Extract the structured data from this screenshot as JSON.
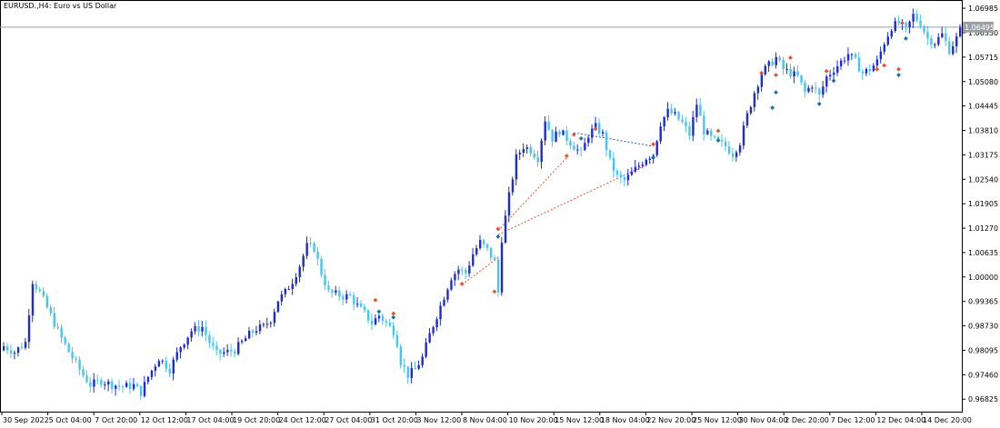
{
  "window": {
    "title": "EURUSD.,H4:  Euro vs US Dollar"
  },
  "price_line": {
    "price": 1.06495,
    "label": "1.06495",
    "color": "#9aa0a6"
  },
  "colors": {
    "bull": "#1d2bd6",
    "bear": "#45c5f2",
    "grid_frame": "#000000",
    "trend_red": "#e8522b",
    "trend_blue": "#1f5fa8",
    "arrow_up": "#1a6fa0",
    "arrow_down": "#e8522b"
  },
  "chart_data": {
    "type": "candlestick",
    "symbol": "EURUSD.",
    "timeframe": "H4",
    "ylim": [
      0.965,
      1.072
    ],
    "y_ticks": [
      "1.06985",
      "1.06350",
      "1.05715",
      "1.05080",
      "1.04445",
      "1.03810",
      "1.03175",
      "1.02540",
      "1.01905",
      "1.01270",
      "1.00635",
      "1.00000",
      "0.99365",
      "0.98730",
      "0.98095",
      "0.97460",
      "0.96825"
    ],
    "x_tick_labels": [
      "30 Sep 2022",
      "5 Oct 04:00",
      "7 Oct 20:00",
      "12 Oct 12:00",
      "17 Oct 04:00",
      "19 Oct 20:00",
      "24 Oct 12:00",
      "27 Oct 04:00",
      "31 Oct 20:00",
      "3 Nov 12:00",
      "8 Nov 04:00",
      "10 Nov 20:00",
      "15 Nov 12:00",
      "18 Nov 04:00",
      "22 Nov 20:00",
      "25 Nov 12:00",
      "30 Nov 04:00",
      "2 Dec 20:00",
      "7 Dec 12:00",
      "12 Dec 04:00",
      "14 Dec 20:00"
    ],
    "close_path": [
      [
        0,
        0.982
      ],
      [
        3,
        0.9805
      ],
      [
        6,
        0.983
      ],
      [
        8,
        0.999
      ],
      [
        10,
        0.996
      ],
      [
        13,
        0.99
      ],
      [
        16,
        0.984
      ],
      [
        19,
        0.979
      ],
      [
        22,
        0.9745
      ],
      [
        24,
        0.972
      ],
      [
        27,
        0.973
      ],
      [
        30,
        0.972
      ],
      [
        33,
        0.9715
      ],
      [
        36,
        0.9718
      ],
      [
        38,
        0.97
      ],
      [
        40,
        0.974
      ],
      [
        43,
        0.979
      ],
      [
        46,
        0.976
      ],
      [
        49,
        0.982
      ],
      [
        52,
        0.986
      ],
      [
        55,
        0.987
      ],
      [
        57,
        0.983
      ],
      [
        59,
        0.98
      ],
      [
        62,
        0.9805
      ],
      [
        64,
        0.981
      ],
      [
        66,
        0.983
      ],
      [
        68,
        0.985
      ],
      [
        70,
        0.9865
      ],
      [
        72,
        0.987
      ],
      [
        74,
        0.989
      ],
      [
        76,
        0.994
      ],
      [
        78,
        0.996
      ],
      [
        80,
        0.999
      ],
      [
        82,
        1.003
      ],
      [
        84,
        1.008
      ],
      [
        86,
        1.0075
      ],
      [
        88,
        1.001
      ],
      [
        90,
        0.996
      ],
      [
        92,
        0.9955
      ],
      [
        94,
        0.995
      ],
      [
        96,
        0.995
      ],
      [
        98,
        0.9925
      ],
      [
        100,
        0.9905
      ],
      [
        102,
        0.988
      ],
      [
        104,
        0.99
      ],
      [
        106,
        0.988
      ],
      [
        108,
        0.986
      ],
      [
        109,
        0.983
      ],
      [
        110,
        0.978
      ],
      [
        112,
        0.9745
      ],
      [
        114,
        0.976
      ],
      [
        116,
        0.979
      ],
      [
        118,
        0.985
      ],
      [
        120,
        0.99
      ],
      [
        122,
        0.995
      ],
      [
        124,
        1.0
      ],
      [
        126,
        1.002
      ],
      [
        128,
        1.001
      ],
      [
        130,
        1.006
      ],
      [
        132,
        1.009
      ],
      [
        134,
        1.007
      ],
      [
        136,
        1.004
      ],
      [
        137,
        0.996
      ],
      [
        138,
        1.01
      ],
      [
        140,
        1.021
      ],
      [
        142,
        1.031
      ],
      [
        144,
        1.034
      ],
      [
        146,
        1.033
      ],
      [
        148,
        1.031
      ],
      [
        150,
        1.041
      ],
      [
        152,
        1.036
      ],
      [
        154,
        1.038
      ],
      [
        156,
        1.036
      ],
      [
        158,
        1.034
      ],
      [
        160,
        1.032
      ],
      [
        162,
        1.037
      ],
      [
        164,
        1.039
      ],
      [
        166,
        1.037
      ],
      [
        168,
        1.03
      ],
      [
        170,
        1.026
      ],
      [
        172,
        1.025
      ],
      [
        174,
        1.027
      ],
      [
        176,
        1.029
      ],
      [
        178,
        1.031
      ],
      [
        180,
        1.032
      ],
      [
        182,
        1.04
      ],
      [
        184,
        1.043
      ],
      [
        186,
        1.042
      ],
      [
        188,
        1.04
      ],
      [
        190,
        1.037
      ],
      [
        192,
        1.045
      ],
      [
        194,
        1.038
      ],
      [
        196,
        1.036
      ],
      [
        198,
        1.035
      ],
      [
        200,
        1.034
      ],
      [
        202,
        1.032
      ],
      [
        204,
        1.035
      ],
      [
        206,
        1.042
      ],
      [
        208,
        1.048
      ],
      [
        210,
        1.053
      ],
      [
        212,
        1.055
      ],
      [
        214,
        1.057
      ],
      [
        216,
        1.054
      ],
      [
        218,
        1.053
      ],
      [
        220,
        1.052
      ],
      [
        222,
        1.048
      ],
      [
        224,
        1.05
      ],
      [
        226,
        1.047
      ],
      [
        228,
        1.052
      ],
      [
        230,
        1.054
      ],
      [
        232,
        1.056
      ],
      [
        234,
        1.058
      ],
      [
        236,
        1.056
      ],
      [
        238,
        1.053
      ],
      [
        240,
        1.054
      ],
      [
        242,
        1.056
      ],
      [
        244,
        1.061
      ],
      [
        246,
        1.065
      ],
      [
        248,
        1.066
      ],
      [
        250,
        1.064
      ],
      [
        252,
        1.068
      ],
      [
        254,
        1.066
      ],
      [
        256,
        1.062
      ],
      [
        258,
        1.061
      ],
      [
        260,
        1.063
      ],
      [
        262,
        1.059
      ],
      [
        264,
        1.062
      ],
      [
        265,
        1.064
      ]
    ],
    "trend_lines": [
      {
        "x1": 137,
        "y1": 1.012,
        "x2": 156,
        "y2": 1.031,
        "color": "red"
      },
      {
        "x1": 137,
        "y1": 1.011,
        "x2": 180,
        "y2": 1.03,
        "color": "red"
      },
      {
        "x1": 127,
        "y1": 0.998,
        "x2": 137,
        "y2": 1.005,
        "color": "red"
      },
      {
        "x1": 158,
        "y1": 1.0375,
        "x2": 180,
        "y2": 1.034,
        "color": "blue"
      }
    ],
    "arrows": [
      {
        "x": 103,
        "y": 0.994,
        "dir": "down"
      },
      {
        "x": 104,
        "y": 0.991,
        "dir": "up"
      },
      {
        "x": 108,
        "y": 0.9905,
        "dir": "down"
      },
      {
        "x": 108,
        "y": 0.9895,
        "dir": "up"
      },
      {
        "x": 127,
        "y": 0.9982,
        "dir": "down"
      },
      {
        "x": 137,
        "y": 1.0125,
        "dir": "down"
      },
      {
        "x": 137,
        "y": 1.0105,
        "dir": "up"
      },
      {
        "x": 136,
        "y": 0.9962,
        "dir": "down"
      },
      {
        "x": 156,
        "y": 1.0315,
        "dir": "down"
      },
      {
        "x": 158,
        "y": 1.037,
        "dir": "down"
      },
      {
        "x": 160,
        "y": 1.036,
        "dir": "up"
      },
      {
        "x": 164,
        "y": 1.0385,
        "dir": "down"
      },
      {
        "x": 180,
        "y": 1.0345,
        "dir": "down"
      },
      {
        "x": 180,
        "y": 1.031,
        "dir": "up"
      },
      {
        "x": 198,
        "y": 1.038,
        "dir": "down"
      },
      {
        "x": 198,
        "y": 1.0355,
        "dir": "up"
      },
      {
        "x": 210,
        "y": 1.053,
        "dir": "down"
      },
      {
        "x": 214,
        "y": 1.0525,
        "dir": "down"
      },
      {
        "x": 214,
        "y": 1.048,
        "dir": "up"
      },
      {
        "x": 213,
        "y": 1.044,
        "dir": "up"
      },
      {
        "x": 218,
        "y": 1.057,
        "dir": "down"
      },
      {
        "x": 228,
        "y": 1.0535,
        "dir": "down"
      },
      {
        "x": 226,
        "y": 1.045,
        "dir": "up"
      },
      {
        "x": 230,
        "y": 1.051,
        "dir": "up"
      },
      {
        "x": 242,
        "y": 1.054,
        "dir": "down"
      },
      {
        "x": 244,
        "y": 1.055,
        "dir": "down"
      },
      {
        "x": 248,
        "y": 1.054,
        "dir": "down"
      },
      {
        "x": 248,
        "y": 1.0525,
        "dir": "up"
      },
      {
        "x": 249,
        "y": 1.066,
        "dir": "down"
      },
      {
        "x": 250,
        "y": 1.062,
        "dir": "up"
      }
    ]
  }
}
